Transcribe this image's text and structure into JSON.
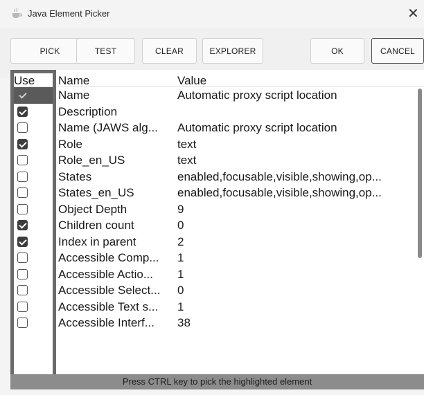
{
  "window": {
    "title": "Java Element Picker",
    "icon": "java-cup-icon",
    "close_glyph": "✕"
  },
  "toolbar": {
    "pick": "PICK",
    "test": "TEST",
    "clear": "CLEAR",
    "explorer": "EXPLORER",
    "ok": "OK",
    "cancel": "CANCEL"
  },
  "table": {
    "columns": {
      "use": "Use",
      "name": "Name",
      "value": "Value"
    },
    "rows": [
      {
        "checked": true,
        "name": "Name",
        "value": "Automatic proxy script location"
      },
      {
        "checked": true,
        "name": "Description",
        "value": ""
      },
      {
        "checked": false,
        "name": "Name (JAWS alg...",
        "value": "Automatic proxy script location"
      },
      {
        "checked": true,
        "name": "Role",
        "value": "text"
      },
      {
        "checked": false,
        "name": "Role_en_US",
        "value": "text"
      },
      {
        "checked": false,
        "name": "States",
        "value": "enabled,focusable,visible,showing,op..."
      },
      {
        "checked": false,
        "name": "States_en_US",
        "value": "enabled,focusable,visible,showing,op..."
      },
      {
        "checked": false,
        "name": "Object Depth",
        "value": "9"
      },
      {
        "checked": true,
        "name": "Children count",
        "value": "0"
      },
      {
        "checked": true,
        "name": "Index in parent",
        "value": "2"
      },
      {
        "checked": false,
        "name": "Accessible Comp...",
        "value": "1"
      },
      {
        "checked": false,
        "name": "Accessible Actio...",
        "value": "1"
      },
      {
        "checked": false,
        "name": "Accessible Select...",
        "value": "0"
      },
      {
        "checked": false,
        "name": "Accessible Text s...",
        "value": "1"
      },
      {
        "checked": false,
        "name": "Accessible Interf...",
        "value": "38"
      }
    ]
  },
  "status": {
    "message": "Press CTRL key to pick the highlighted element"
  },
  "colors": {
    "highlight_frame": "#6a6a6a",
    "status_bar": "#8c8c8c",
    "checkbox_checked": "#3d3d3d"
  }
}
